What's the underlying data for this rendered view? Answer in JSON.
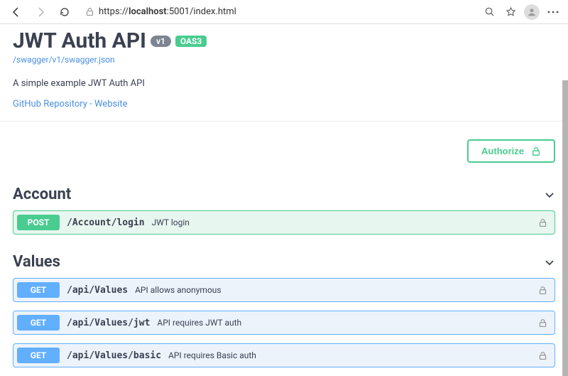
{
  "browser": {
    "url_pre": "https://",
    "url_host": "localhost",
    "url_port": ":5001",
    "url_path": "/index.html"
  },
  "page": {
    "title": "JWT Auth API",
    "version_badge": "v1",
    "oas_badge": "OAS3",
    "spec_link": "/swagger/v1/swagger.json",
    "description": "A simple example JWT Auth API",
    "external_link": "GitHub Repository - Website",
    "authorize_label": "Authorize"
  },
  "sections": [
    {
      "name": "Account",
      "ops": [
        {
          "method": "POST",
          "path": "/Account/login",
          "summary": "JWT login",
          "lock": true
        }
      ]
    },
    {
      "name": "Values",
      "ops": [
        {
          "method": "GET",
          "path": "/api/Values",
          "summary": "API allows anonymous",
          "lock": true
        },
        {
          "method": "GET",
          "path": "/api/Values/jwt",
          "summary": "API requires JWT auth",
          "lock": true
        },
        {
          "method": "GET",
          "path": "/api/Values/basic",
          "summary": "API requires Basic auth",
          "lock": true
        }
      ]
    }
  ]
}
